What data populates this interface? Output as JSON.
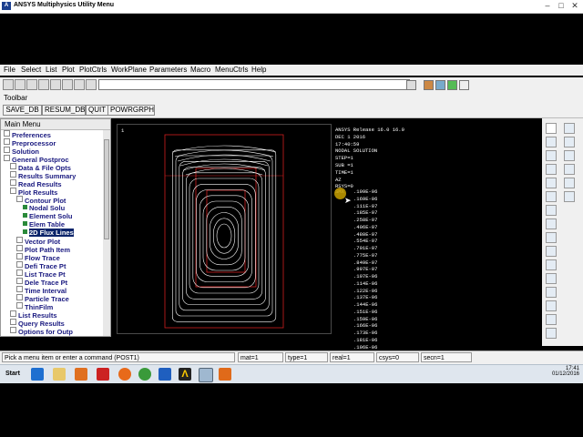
{
  "window": {
    "title": "ANSYS Multiphysics Utility Menu",
    "logo_text": "A",
    "controls": [
      "–",
      "□",
      "✕"
    ]
  },
  "menubar": {
    "items": [
      "File",
      "Select",
      "List",
      "Plot",
      "PlotCtrls",
      "WorkPlane",
      "Parameters",
      "Macro",
      "MenuCtrls",
      "Help"
    ]
  },
  "toolbar": {
    "label": "Toolbar",
    "buttons": [
      "SAVE_DB",
      "RESUM_DB",
      "QUIT",
      "POWRGRPH"
    ],
    "command_value": ""
  },
  "main_menu": {
    "title": "Main Menu",
    "items": [
      {
        "label": "Preferences",
        "level": 0
      },
      {
        "label": "Preprocessor",
        "level": 0
      },
      {
        "label": "Solution",
        "level": 0
      },
      {
        "label": "General Postproc",
        "level": 0
      },
      {
        "label": "Data & File Opts",
        "level": 1
      },
      {
        "label": "Results Summary",
        "level": 1
      },
      {
        "label": "Read Results",
        "level": 1
      },
      {
        "label": "Plot Results",
        "level": 1
      },
      {
        "label": "Contour Plot",
        "level": 2
      },
      {
        "label": "Nodal Solu",
        "level": 3
      },
      {
        "label": "Element Solu",
        "level": 3
      },
      {
        "label": "Elem Table",
        "level": 3
      },
      {
        "label": "2D Flux Lines",
        "level": 3,
        "selected": true
      },
      {
        "label": "Vector Plot",
        "level": 2
      },
      {
        "label": "Plot Path Item",
        "level": 2
      },
      {
        "label": "Flow Trace",
        "level": 2
      },
      {
        "label": "Defi Trace Pt",
        "level": 2
      },
      {
        "label": "List Trace Pt",
        "level": 2
      },
      {
        "label": "Dele Trace Pt",
        "level": 2
      },
      {
        "label": "Time Interval",
        "level": 2
      },
      {
        "label": "Particle Trace",
        "level": 2
      },
      {
        "label": "ThinFilm",
        "level": 2
      },
      {
        "label": "List Results",
        "level": 1
      },
      {
        "label": "Query Results",
        "level": 1
      },
      {
        "label": "Options for Outp",
        "level": 1
      }
    ]
  },
  "graphics": {
    "window_number": "1",
    "info_lines": [
      "ANSYS Release 16.0        16.0",
      "DEC  1 2016",
      "17:40:59",
      "NODAL SOLUTION",
      "STEP=1",
      "SUB =1",
      "TIME=1",
      "AZ",
      "RSYS=0"
    ],
    "contour_values": [
      ".199E-06",
      ".169E-06",
      ".111E-07",
      ".185E-07",
      ".258E-07",
      ".406E-07",
      ".480E-07",
      ".554E-07",
      ".701E-07",
      ".775E-07",
      ".849E-07",
      ".997E-07",
      ".107E-06",
      ".114E-06",
      ".122E-06",
      ".137E-06",
      ".144E-06",
      ".151E-06",
      ".159E-06",
      ".166E-06",
      ".173E-06",
      ".181E-06",
      ".196E-06"
    ],
    "first_label_prefix": "SMX"
  },
  "status_bar": {
    "prompt": "Pick a menu item or enter a command (POST1)",
    "mat": "mat=1",
    "type": "type=1",
    "real": "real=1",
    "csys": "csys=0",
    "secn": "secn=1"
  },
  "taskbar": {
    "start_label": "Start",
    "clock_time": "17:41",
    "clock_date": "01/12/2016",
    "icons": [
      "ie-icon",
      "folder-icon",
      "media-icon",
      "pdf-icon",
      "firefox-icon",
      "chrome-icon",
      "outlook-icon",
      "ansys-icon",
      "window-icon",
      "app-icon"
    ]
  },
  "colors": {
    "title_accent": "#1b3f8f",
    "selection": "#0a246a",
    "graph_bg": "#000000",
    "highlight": "#c8a000"
  }
}
